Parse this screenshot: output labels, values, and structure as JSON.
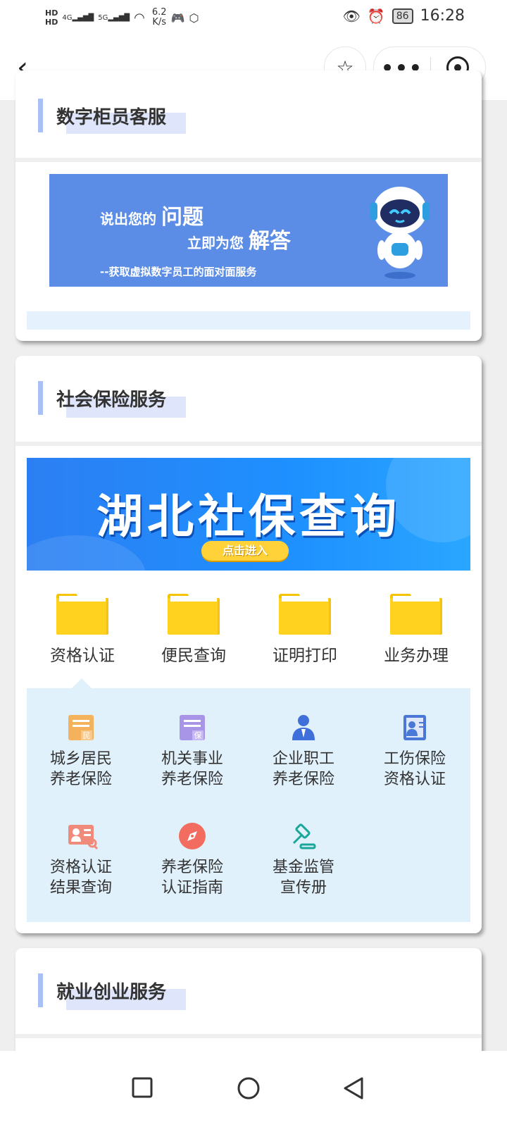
{
  "status_bar": {
    "hd1": "HD",
    "hd2": "HD",
    "signal1": "4G",
    "signal2": "5G",
    "net_speed_value": "6.2",
    "net_speed_unit": "K/s",
    "battery": "86",
    "time": "16:28"
  },
  "nav": {
    "back_icon": "chevron-left-icon",
    "star_icon": "star-icon",
    "more_icon": "more-dots-icon",
    "target_icon": "target-icon"
  },
  "section_digital": {
    "title": "数字柜员客服",
    "banner": {
      "line1_prefix": "说出您的",
      "line1_big": "问题",
      "line2_prefix": "立即为您",
      "line2_big": "解答",
      "line3": "--获取虚拟数字员工的面对面服务"
    }
  },
  "section_social": {
    "title": "社会保险服务",
    "banner": {
      "title": "湖北社保查询",
      "button": "点击进入"
    },
    "tabs": [
      {
        "label": "资格认证"
      },
      {
        "label": "便民查询"
      },
      {
        "label": "证明打印"
      },
      {
        "label": "业务办理"
      }
    ],
    "subitems": [
      {
        "line1": "城乡居民",
        "line2": "养老保险",
        "badge": "民"
      },
      {
        "line1": "机关事业",
        "line2": "养老保险",
        "badge": "保"
      },
      {
        "line1": "企业职工",
        "line2": "养老保险"
      },
      {
        "line1": "工伤保险",
        "line2": "资格认证"
      },
      {
        "line1": "资格认证",
        "line2": "结果查询"
      },
      {
        "line1": "养老保险",
        "line2": "认证指南"
      },
      {
        "line1": "基金监管",
        "line2": "宣传册"
      }
    ]
  },
  "section_employment": {
    "title": "就业创业服务"
  },
  "colors": {
    "accent_bar": "#a9c0f5",
    "banner_blue": "#5b8de6",
    "panel_light": "#e1f1fc",
    "folder_yellow": "#ffd21f"
  }
}
